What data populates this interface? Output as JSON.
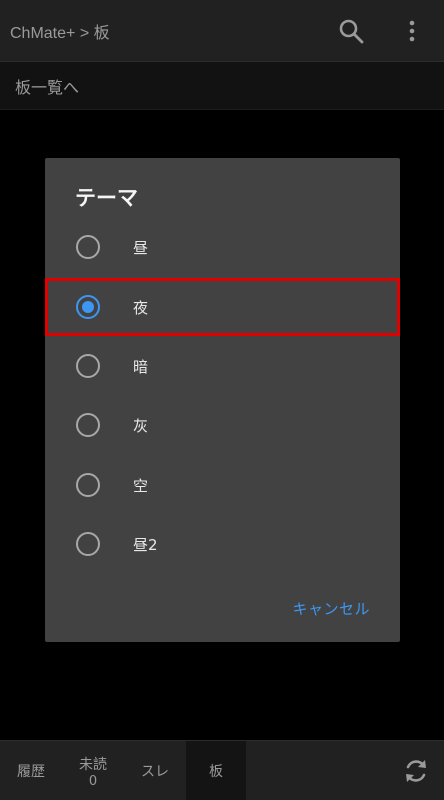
{
  "appbar": {
    "title": "ChMate+ > 板",
    "search_icon": "search-icon",
    "menu_icon": "more-vertical-icon"
  },
  "subbar": {
    "text": "板一覧へ"
  },
  "dialog": {
    "title": "テーマ",
    "options": [
      {
        "label": "昼",
        "selected": false
      },
      {
        "label": "夜",
        "selected": true
      },
      {
        "label": "暗",
        "selected": false
      },
      {
        "label": "灰",
        "selected": false
      },
      {
        "label": "空",
        "selected": false
      },
      {
        "label": "昼2",
        "selected": false
      }
    ],
    "cancel_label": "キャンセル"
  },
  "bottombar": {
    "tabs": [
      {
        "label": "履歴"
      },
      {
        "label": "未読",
        "count": "0"
      },
      {
        "label": "スレ"
      },
      {
        "label": "板",
        "active": true
      }
    ],
    "refresh_icon": "refresh-icon"
  },
  "colors": {
    "accent": "#3d97f2",
    "highlight": "#e00000",
    "dialog_bg": "#424242",
    "appbar_bg": "#212121"
  }
}
